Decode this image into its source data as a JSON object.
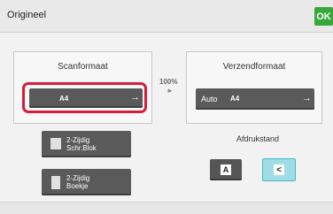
{
  "header": {
    "title": "Origineel",
    "ok_label": "OK"
  },
  "scan": {
    "title": "Scanformaat",
    "size_value": "A4",
    "arrow": "→"
  },
  "zoom": {
    "value": "100%",
    "arrow": "►"
  },
  "send": {
    "title": "Verzendformaat",
    "auto_label": "Auto",
    "size_value": "A4",
    "arrow": "→"
  },
  "duplex": [
    {
      "label_line1": "2-Zijdig",
      "label_line2": "Schr.Blok",
      "icon": "book-flat-icon"
    },
    {
      "label_line1": "2-Zijdig",
      "label_line2": "Boekje",
      "icon": "booklet-icon"
    }
  ],
  "orientation": {
    "title": "Afdrukstand",
    "options": [
      {
        "glyph": "A",
        "selected": false,
        "icon": "portrait-orientation-icon"
      },
      {
        "glyph": "<",
        "selected": true,
        "icon": "landscape-orientation-icon"
      }
    ]
  },
  "colors": {
    "ok_green": "#37a93a",
    "highlight_red": "#d61c3a",
    "selected_cyan": "#9fdde6",
    "dark_button": "#5a5a5a"
  }
}
